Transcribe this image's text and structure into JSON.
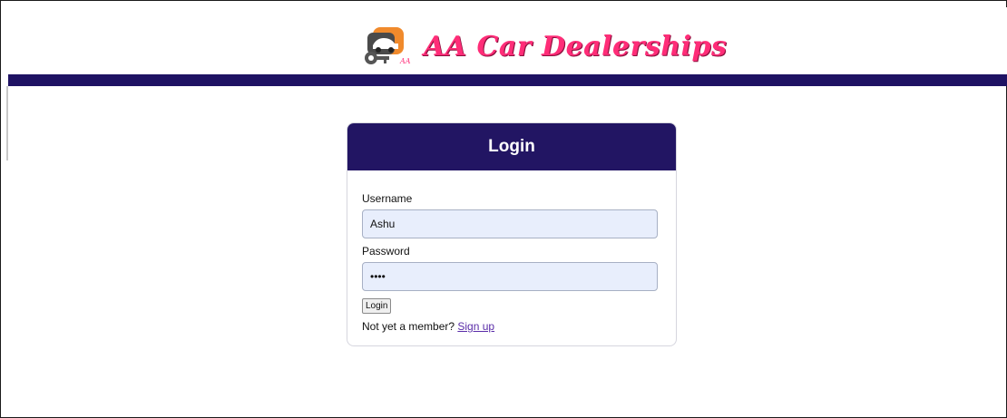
{
  "header": {
    "brand_name": "AA Car Dealerships",
    "logo_icon": "car-keys-logo-icon",
    "brand_color": "#ff2d78",
    "nav_color": "#1f1263"
  },
  "login_card": {
    "title": "Login",
    "username_label": "Username",
    "username_value": "Ashu",
    "password_label": "Password",
    "password_value": "••••",
    "login_button_label": "Login",
    "member_prompt": "Not yet a member?",
    "signup_link_label": "Sign up"
  }
}
